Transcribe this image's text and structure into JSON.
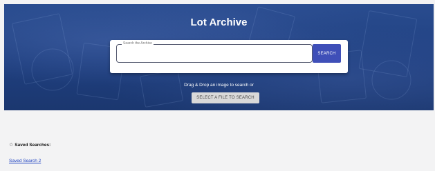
{
  "hero": {
    "title": "Lot Archive"
  },
  "search": {
    "legend": "Search the Archive",
    "value": "",
    "button_label": "SEARCH"
  },
  "upload": {
    "drag_text": "Drag & Drop an image to search or",
    "select_button_label": "SELECT A FILE TO SEARCH"
  },
  "saved_searches": {
    "icon": "star-outline-icon",
    "heading": "Saved Searches:",
    "items": [
      {
        "label": "Saved Search 2"
      }
    ]
  },
  "colors": {
    "hero_background": "#1f3f7f",
    "search_button": "#3f4fb8",
    "select_button": "#d9d9d9",
    "link": "#1a3fc0",
    "page_background": "#f3f3f4"
  }
}
